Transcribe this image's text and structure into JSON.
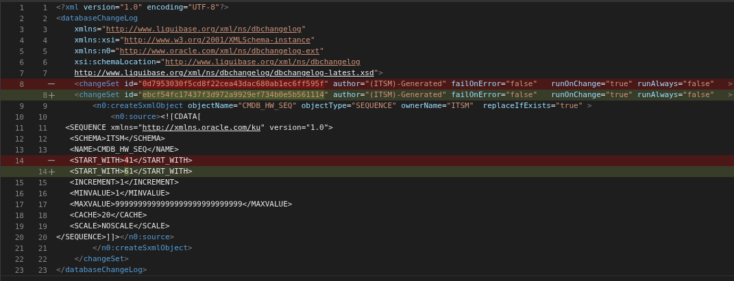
{
  "diff_rows": [
    {
      "old": "1",
      "new": "1",
      "kind": "unchanged",
      "tokens": [
        {
          "kind": "punct",
          "text": "<?"
        },
        {
          "kind": "tag",
          "text": "xml"
        },
        {
          "kind": "attr",
          "text": " version"
        },
        {
          "kind": "text",
          "text": "="
        },
        {
          "kind": "string",
          "text": "\"1.0\""
        },
        {
          "kind": "attr",
          "text": " encoding"
        },
        {
          "kind": "text",
          "text": "="
        },
        {
          "kind": "string",
          "text": "\"UTF-8\""
        },
        {
          "kind": "punct",
          "text": "?>"
        }
      ]
    },
    {
      "old": "2",
      "new": "2",
      "kind": "unchanged",
      "tokens": [
        {
          "kind": "punct",
          "text": "<"
        },
        {
          "kind": "tag",
          "text": "databaseChangeLog"
        }
      ]
    },
    {
      "old": "3",
      "new": "3",
      "kind": "unchanged",
      "tokens": [
        {
          "kind": "attr",
          "text": "    xmlns"
        },
        {
          "kind": "text",
          "text": "="
        },
        {
          "kind": "string",
          "text": "\""
        },
        {
          "kind": "url",
          "text": "http://www.liquibase.org/xml/ns/dbchangelog"
        },
        {
          "kind": "string",
          "text": "\""
        }
      ]
    },
    {
      "old": "4",
      "new": "4",
      "kind": "unchanged",
      "tokens": [
        {
          "kind": "attr",
          "text": "    xmlns:xsi"
        },
        {
          "kind": "text",
          "text": "="
        },
        {
          "kind": "string",
          "text": "\""
        },
        {
          "kind": "url",
          "text": "http://www.w3.org/2001/XMLSchema-instance"
        },
        {
          "kind": "string",
          "text": "\""
        }
      ]
    },
    {
      "old": "5",
      "new": "5",
      "kind": "unchanged",
      "tokens": [
        {
          "kind": "attr",
          "text": "    xmlns:n0"
        },
        {
          "kind": "text",
          "text": "="
        },
        {
          "kind": "string",
          "text": "\""
        },
        {
          "kind": "url",
          "text": "http://www.oracle.com/xml/ns/dbchangelog-ext"
        },
        {
          "kind": "string",
          "text": "\""
        }
      ]
    },
    {
      "old": "6",
      "new": "6",
      "kind": "unchanged",
      "tokens": [
        {
          "kind": "attr",
          "text": "    xsi:schemaLocation"
        },
        {
          "kind": "text",
          "text": "="
        },
        {
          "kind": "string",
          "text": "\""
        },
        {
          "kind": "url",
          "text": "http://www.liquibase.org/xml/ns/dbchangelog"
        }
      ]
    },
    {
      "old": "7",
      "new": "7",
      "kind": "unchanged",
      "tokens": [
        {
          "kind": "link",
          "text": "    http://www.liquibase.org/xml/ns/dbchangelog/dbchangelog-latest.xsd"
        },
        {
          "kind": "string",
          "text": "\""
        },
        {
          "kind": "punct",
          "text": ">"
        }
      ]
    },
    {
      "old": "8",
      "kind": "removed",
      "tokens": [
        {
          "kind": "punct",
          "text": "    <",
          "changed": false
        },
        {
          "kind": "tag",
          "text": "changeSet",
          "changed": false
        },
        {
          "kind": "attr",
          "text": " id",
          "changed": false
        },
        {
          "kind": "text",
          "text": "=",
          "changed": false
        },
        {
          "kind": "string",
          "text": "\"",
          "changed": false
        },
        {
          "kind": "string",
          "text": "0d7953030f5cd8f22cea43dac680ab1ec6ff595f",
          "changed": true
        },
        {
          "kind": "string",
          "text": "\"",
          "changed": false
        },
        {
          "kind": "attr",
          "text": " author",
          "changed": false
        },
        {
          "kind": "text",
          "text": "=",
          "changed": false
        },
        {
          "kind": "string",
          "text": "\"(ITSM)-Generated\"",
          "changed": false
        },
        {
          "kind": "attr",
          "text": " failOnError",
          "changed": false
        },
        {
          "kind": "text",
          "text": "=",
          "changed": false
        },
        {
          "kind": "string",
          "text": "\"false\"",
          "changed": false
        },
        {
          "kind": "attr",
          "text": "   runOnChange",
          "changed": false
        },
        {
          "kind": "text",
          "text": "=",
          "changed": false
        },
        {
          "kind": "string",
          "text": "\"true\"",
          "changed": false
        },
        {
          "kind": "attr",
          "text": " runAlways",
          "changed": false
        },
        {
          "kind": "text",
          "text": "=",
          "changed": false
        },
        {
          "kind": "string",
          "text": "\"false\"",
          "changed": false
        },
        {
          "kind": "punct",
          "text": "   >",
          "changed": false
        }
      ]
    },
    {
      "new": "8",
      "kind": "added",
      "tokens": [
        {
          "kind": "punct",
          "text": "    <",
          "changed": false
        },
        {
          "kind": "tag",
          "text": "changeSet",
          "changed": false
        },
        {
          "kind": "attr",
          "text": " id",
          "changed": false
        },
        {
          "kind": "text",
          "text": "=",
          "changed": false
        },
        {
          "kind": "string",
          "text": "\"",
          "changed": false
        },
        {
          "kind": "string",
          "text": "ebcf54fc17437f3d972a9929ef734b0e5b561114",
          "changed": true
        },
        {
          "kind": "string",
          "text": "\"",
          "changed": false
        },
        {
          "kind": "attr",
          "text": " author",
          "changed": false
        },
        {
          "kind": "text",
          "text": "=",
          "changed": false
        },
        {
          "kind": "string",
          "text": "\"(ITSM)-Generated\"",
          "changed": false
        },
        {
          "kind": "attr",
          "text": " failOnError",
          "changed": false
        },
        {
          "kind": "text",
          "text": "=",
          "changed": false
        },
        {
          "kind": "string",
          "text": "\"false\"",
          "changed": false
        },
        {
          "kind": "attr",
          "text": "   runOnChange",
          "changed": false
        },
        {
          "kind": "text",
          "text": "=",
          "changed": false
        },
        {
          "kind": "string",
          "text": "\"true\"",
          "changed": false
        },
        {
          "kind": "attr",
          "text": " runAlways",
          "changed": false
        },
        {
          "kind": "text",
          "text": "=",
          "changed": false
        },
        {
          "kind": "string",
          "text": "\"false\"",
          "changed": false
        },
        {
          "kind": "punct",
          "text": "   >",
          "changed": false
        }
      ]
    },
    {
      "old": "9",
      "new": "9",
      "kind": "unchanged",
      "tokens": [
        {
          "kind": "punct",
          "text": "        <"
        },
        {
          "kind": "tag",
          "text": "n0:createSxmlObject"
        },
        {
          "kind": "attr",
          "text": " objectName"
        },
        {
          "kind": "text",
          "text": "="
        },
        {
          "kind": "string",
          "text": "\"CMDB_HW_SEQ\""
        },
        {
          "kind": "attr",
          "text": " objectType"
        },
        {
          "kind": "text",
          "text": "="
        },
        {
          "kind": "string",
          "text": "\"SEQUENCE\""
        },
        {
          "kind": "attr",
          "text": " ownerName"
        },
        {
          "kind": "text",
          "text": "="
        },
        {
          "kind": "string",
          "text": "\"ITSM\""
        },
        {
          "kind": "attr",
          "text": "  replaceIfExists"
        },
        {
          "kind": "text",
          "text": "="
        },
        {
          "kind": "string",
          "text": "\"true\""
        },
        {
          "kind": "punct",
          "text": " >"
        }
      ]
    },
    {
      "old": "10",
      "new": "10",
      "kind": "unchanged",
      "tokens": [
        {
          "kind": "punct",
          "text": "            <"
        },
        {
          "kind": "tag",
          "text": "n0:source"
        },
        {
          "kind": "punct",
          "text": ">"
        },
        {
          "kind": "text",
          "text": "<![CDATA["
        }
      ]
    },
    {
      "old": "11",
      "new": "11",
      "kind": "unchanged",
      "tokens": [
        {
          "kind": "text",
          "text": "  <SEQUENCE xmlns=\""
        },
        {
          "kind": "link",
          "text": "http://xmlns.oracle.com/ku"
        },
        {
          "kind": "text",
          "text": "\" version=\"1.0\">"
        }
      ]
    },
    {
      "old": "12",
      "new": "12",
      "kind": "unchanged",
      "tokens": [
        {
          "kind": "text",
          "text": "   <SCHEMA>ITSM</SCHEMA>"
        }
      ]
    },
    {
      "old": "13",
      "new": "13",
      "kind": "unchanged",
      "tokens": [
        {
          "kind": "text",
          "text": "   <NAME>CMDB_HW_SEQ</NAME>"
        }
      ]
    },
    {
      "old": "14",
      "kind": "removed",
      "tokens": [
        {
          "kind": "text",
          "text": "   <START_WITH>",
          "changed": false
        },
        {
          "kind": "text",
          "text": "4",
          "changed": true
        },
        {
          "kind": "text",
          "text": "1</START_WITH>",
          "changed": false
        }
      ]
    },
    {
      "new": "14",
      "kind": "added",
      "tokens": [
        {
          "kind": "text",
          "text": "   <START_WITH>",
          "changed": false
        },
        {
          "kind": "text",
          "text": "6",
          "changed": true
        },
        {
          "kind": "text",
          "text": "1</START_WITH>",
          "changed": false
        }
      ]
    },
    {
      "old": "15",
      "new": "15",
      "kind": "unchanged",
      "tokens": [
        {
          "kind": "text",
          "text": "   <INCREMENT>1</INCREMENT>"
        }
      ]
    },
    {
      "old": "16",
      "new": "16",
      "kind": "unchanged",
      "tokens": [
        {
          "kind": "text",
          "text": "   <MINVALUE>1</MINVALUE>"
        }
      ]
    },
    {
      "old": "17",
      "new": "17",
      "kind": "unchanged",
      "tokens": [
        {
          "kind": "text",
          "text": "   <MAXVALUE>9999999999999999999999999999</MAXVALUE>"
        }
      ]
    },
    {
      "old": "18",
      "new": "18",
      "kind": "unchanged",
      "tokens": [
        {
          "kind": "text",
          "text": "   <CACHE>20</CACHE>"
        }
      ]
    },
    {
      "old": "19",
      "new": "19",
      "kind": "unchanged",
      "tokens": [
        {
          "kind": "text",
          "text": "   <SCALE>NOSCALE</SCALE>"
        }
      ]
    },
    {
      "old": "20",
      "new": "20",
      "kind": "unchanged",
      "tokens": [
        {
          "kind": "text",
          "text": "</SEQUENCE>]]>"
        },
        {
          "kind": "punct",
          "text": "</"
        },
        {
          "kind": "tag",
          "text": "n0:source"
        },
        {
          "kind": "punct",
          "text": ">"
        }
      ]
    },
    {
      "old": "21",
      "new": "21",
      "kind": "unchanged",
      "tokens": [
        {
          "kind": "punct",
          "text": "        </"
        },
        {
          "kind": "tag",
          "text": "n0:createSxmlObject"
        },
        {
          "kind": "punct",
          "text": ">"
        }
      ]
    },
    {
      "old": "22",
      "new": "22",
      "kind": "unchanged",
      "tokens": [
        {
          "kind": "punct",
          "text": "    </"
        },
        {
          "kind": "tag",
          "text": "changeSet"
        },
        {
          "kind": "punct",
          "text": ">"
        }
      ]
    },
    {
      "old": "23",
      "new": "23",
      "kind": "unchanged",
      "tokens": [
        {
          "kind": "punct",
          "text": "</"
        },
        {
          "kind": "tag",
          "text": "databaseChangeLog"
        },
        {
          "kind": "punct",
          "text": ">"
        }
      ]
    }
  ]
}
